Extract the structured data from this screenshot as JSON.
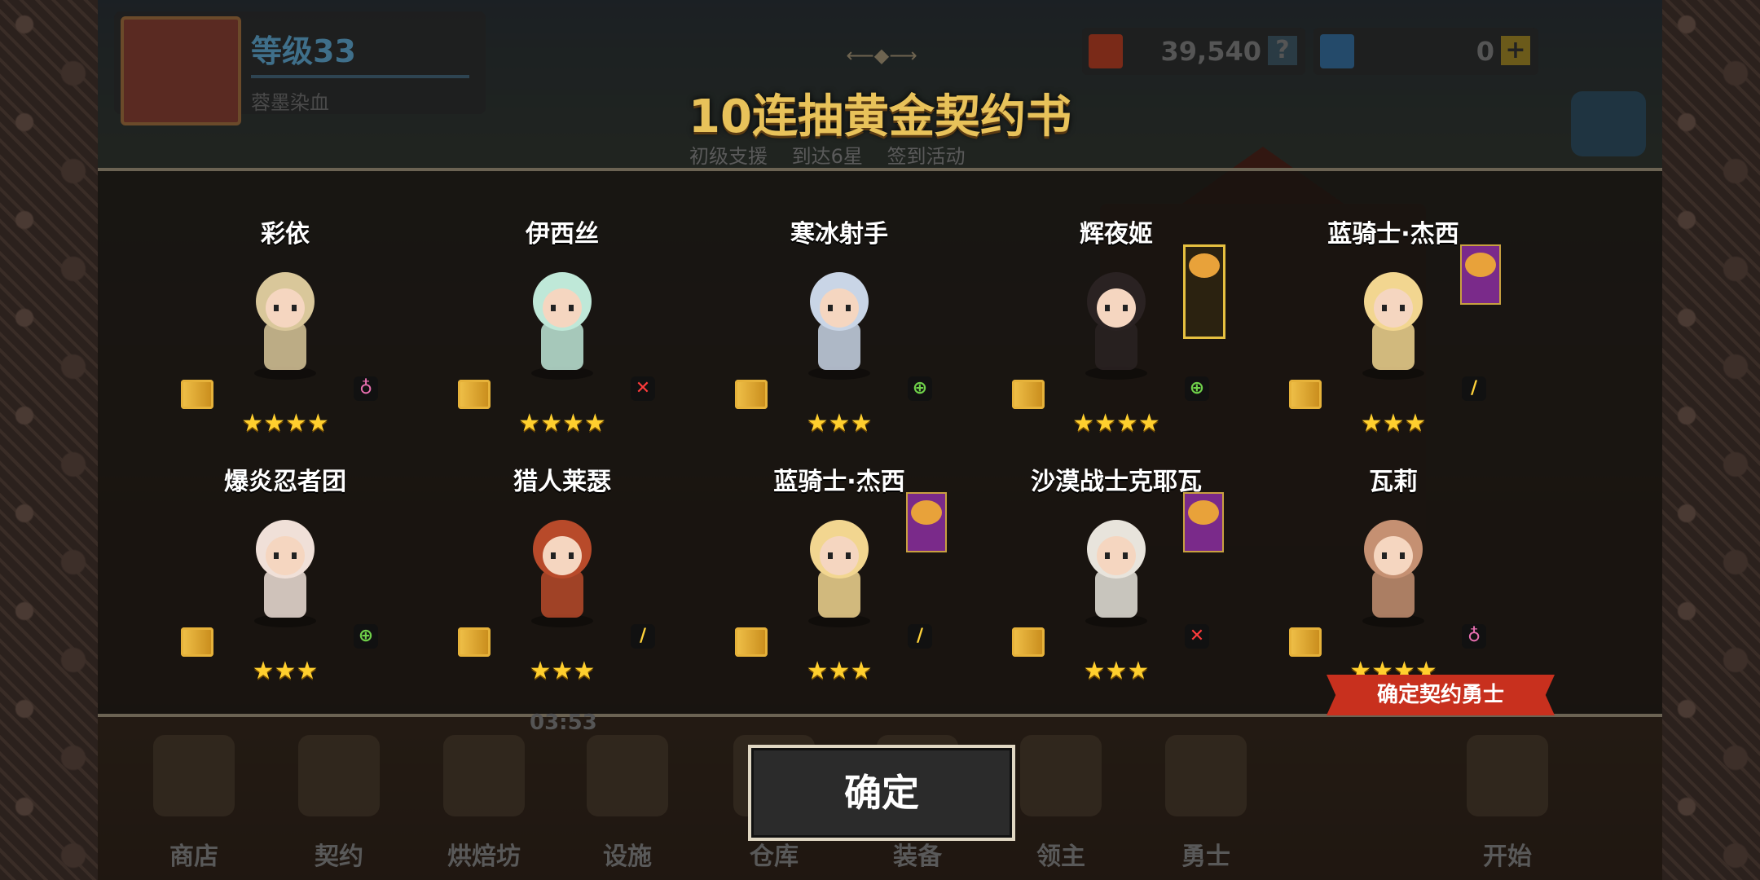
{
  "hud": {
    "level": "等级33",
    "player_name": "蓉墨染血",
    "gold": "39,540",
    "gems": "0"
  },
  "title": "10连抽黄金契约书",
  "subtitles": [
    "初级支援",
    "到达6星",
    "签到活动"
  ],
  "heroes": [
    {
      "name": "彩依",
      "stars": "★★★★",
      "class_icon": "♁",
      "class_color": "#e86fb0",
      "contract": "gold",
      "banner": ""
    },
    {
      "name": "伊西丝",
      "stars": "★★★★",
      "class_icon": "✕",
      "class_color": "#ff3b3b",
      "contract": "gold",
      "banner": ""
    },
    {
      "name": "寒冰射手",
      "stars": "★★★",
      "class_icon": "⊕",
      "class_color": "#6fd04a",
      "contract": "gold",
      "banner": ""
    },
    {
      "name": "辉夜姬",
      "stars": "★★★★",
      "class_icon": "⊕",
      "class_color": "#6fd04a",
      "contract": "gold",
      "banner": "tall"
    },
    {
      "name": "蓝骑士·杰西",
      "stars": "★★★",
      "class_icon": "/",
      "class_color": "#ffd23a",
      "contract": "gold",
      "banner": "purple"
    },
    {
      "name": "爆炎忍者团",
      "stars": "★★★",
      "class_icon": "⊕",
      "class_color": "#6fd04a",
      "contract": "gold",
      "banner": ""
    },
    {
      "name": "猎人莱瑟",
      "stars": "★★★",
      "class_icon": "/",
      "class_color": "#ffd23a",
      "contract": "gold",
      "banner": ""
    },
    {
      "name": "蓝骑士·杰西",
      "stars": "★★★",
      "class_icon": "/",
      "class_color": "#ffd23a",
      "contract": "gold",
      "banner": "purple"
    },
    {
      "name": "沙漠战士克耶瓦",
      "stars": "★★★",
      "class_icon": "✕",
      "class_color": "#ff3b3b",
      "contract": "gold",
      "banner": "purple"
    },
    {
      "name": "瓦莉",
      "stars": "★★★★",
      "class_icon": "♁",
      "class_color": "#e86fb0",
      "contract": "gold",
      "banner": ""
    }
  ],
  "confirm_ribbon": "确定契约勇士",
  "confirm_button": "确定",
  "nav": {
    "timer": "03:53",
    "items": [
      "商店",
      "契约",
      "烘焙坊",
      "设施",
      "仓库",
      "装备",
      "领主",
      "勇士",
      "开始"
    ]
  }
}
